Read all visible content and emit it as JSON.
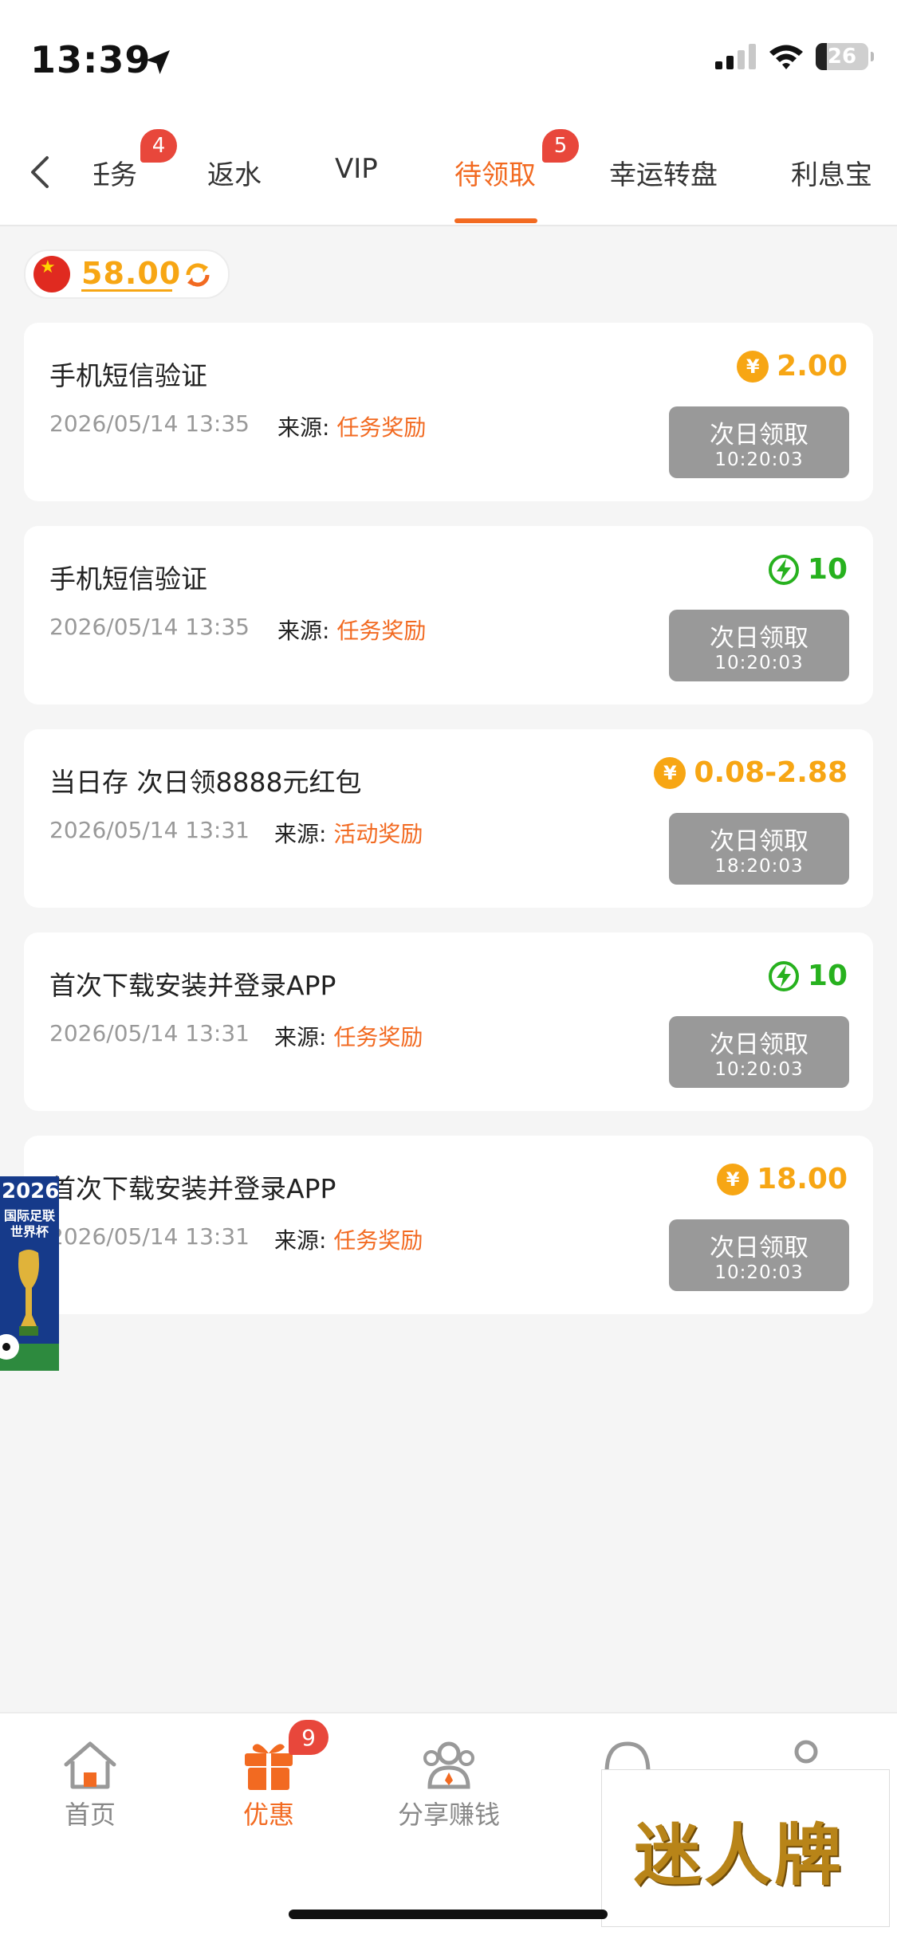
{
  "status_bar": {
    "time": "13:39",
    "battery": "26"
  },
  "tabs": [
    {
      "label": "任务",
      "badge": "4"
    },
    {
      "label": "返水",
      "badge": ""
    },
    {
      "label": "VIP",
      "badge": ""
    },
    {
      "label": "待领取",
      "badge": "5",
      "active": true
    },
    {
      "label": "幸运转盘",
      "badge": ""
    },
    {
      "label": "利息宝",
      "badge": ""
    }
  ],
  "balance": {
    "amount": "58.00"
  },
  "source_label": "来源:",
  "claim_label": "次日领取",
  "items": [
    {
      "title": "手机短信验证",
      "date": "2026/05/14 13:35",
      "source": "任务奖励",
      "reward": "2.00",
      "reward_type": "coin",
      "timer": "10:20:03"
    },
    {
      "title": "手机短信验证",
      "date": "2026/05/14 13:35",
      "source": "任务奖励",
      "reward": "10",
      "reward_type": "energy",
      "timer": "10:20:03"
    },
    {
      "title": "当日存 次日领8888元红包",
      "date": "2026/05/14 13:31",
      "source": "活动奖励",
      "reward": "0.08-2.88",
      "reward_type": "coin",
      "timer": "18:20:03"
    },
    {
      "title": "首次下载安装并登录APP",
      "date": "2026/05/14 13:31",
      "source": "任务奖励",
      "reward": "10",
      "reward_type": "energy",
      "timer": "10:20:03"
    },
    {
      "title": "首次下载安装并登录APP",
      "date": "2026/05/14 13:31",
      "source": "任务奖励",
      "reward": "18.00",
      "reward_type": "coin",
      "timer": "10:20:03"
    }
  ],
  "promo_left": {
    "year": "2026",
    "subtitle": "国际足联世界杯"
  },
  "bottom_nav": [
    {
      "label": "首页",
      "icon": "home-icon"
    },
    {
      "label": "优惠",
      "icon": "gift-icon",
      "badge": "9",
      "active": true
    },
    {
      "label": "分享赚钱",
      "icon": "share-people-icon"
    },
    {
      "label": "",
      "icon": "headset-icon"
    },
    {
      "label": "",
      "icon": "profile-icon"
    }
  ],
  "ad_overlay": {
    "text": "迷人牌"
  },
  "colors": {
    "accent": "#f26a21",
    "coin": "#f7a614",
    "energy": "#27b11e",
    "badge": "#e8473b",
    "button_gray": "#999999"
  }
}
